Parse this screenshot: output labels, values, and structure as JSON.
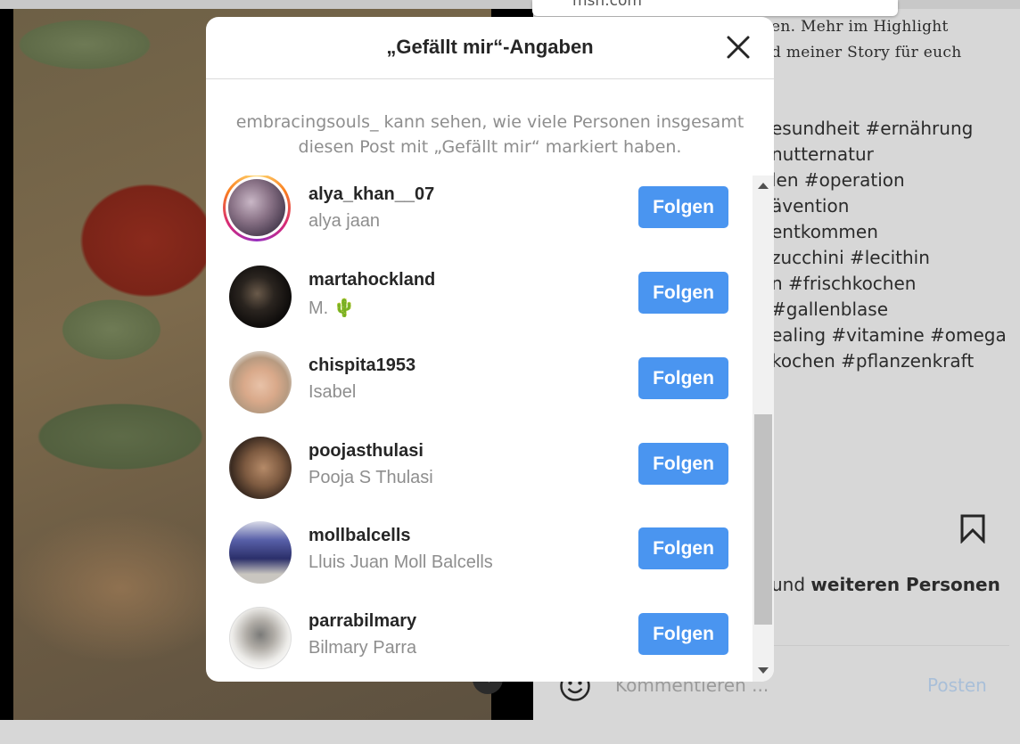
{
  "browser": {
    "dropdown_fragment_text": "msn.com"
  },
  "post": {
    "caption_lines": [
      "en. Mehr im Highlight",
      "d meiner Story für euch"
    ],
    "separator": "---------------------------",
    "hashtag_lines": [
      "esundheit #ernährung",
      "nutternatur",
      "len #operation",
      "ävention",
      "entkommen",
      "zucchini #lecithin",
      "n #frischkochen",
      "#gallenblase",
      "ealing #vitamine #omega",
      "kochen #pflanzenkraft"
    ],
    "likes_prefix": "und ",
    "likes_bold": "weiteren Personen",
    "comment_placeholder": "Kommentieren ...",
    "post_button_label": "Posten"
  },
  "likes_modal": {
    "title": "„Gefällt mir“-Angaben",
    "privacy_note": "embracingsouls_ kann sehen, wie viele Personen insgesamt diesen Post mit „Gefällt mir“ markiert haben.",
    "follow_label": "Folgen",
    "users": [
      {
        "username": "alya_khan__07",
        "full_name": "alya jaan",
        "has_story": true
      },
      {
        "username": "martahockland",
        "full_name": "M. 🌵",
        "has_story": false
      },
      {
        "username": "chispita1953",
        "full_name": "Isabel",
        "has_story": false
      },
      {
        "username": "poojasthulasi",
        "full_name": "Pooja S Thulasi",
        "has_story": false
      },
      {
        "username": "mollbalcells",
        "full_name": "Lluis Juan Moll Balcells",
        "has_story": false
      },
      {
        "username": "parrabilmary",
        "full_name": "Bilmary Parra",
        "has_story": false
      }
    ]
  },
  "colors": {
    "follow_button": "#4a95f0",
    "story_ring": "#d62976",
    "muted_text": "#8e8e8e"
  }
}
